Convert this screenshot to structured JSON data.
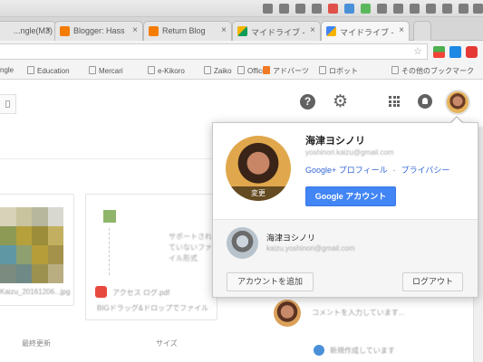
{
  "tabs": [
    {
      "label": "...ngle(M3)",
      "favicon_color": "#bdbdbd"
    },
    {
      "label": "Blogger: Hass",
      "favicon_color": "#f57c00"
    },
    {
      "label": "Return Blog",
      "favicon_color": "#f57c00"
    },
    {
      "label": "マイドライブ -",
      "favicon_color": "#f4b400"
    },
    {
      "label": "マイドライブ -",
      "favicon_color": "#4285f4"
    }
  ],
  "tab_close_glyph": "×",
  "bookmarks": [
    {
      "label": "ngle"
    },
    {
      "label": "Education"
    },
    {
      "label": "Mercari"
    },
    {
      "label": "e-Kikoro"
    },
    {
      "label": "Zaiko"
    },
    {
      "label": "Office"
    },
    {
      "label": "アドバーツ"
    },
    {
      "label": "ロボット"
    },
    {
      "label": "その他のブックマーク"
    }
  ],
  "header": {
    "help_label": "?",
    "settings_icon": "gear-icon",
    "apps_icon": "apps-grid-icon",
    "notifications_icon": "bell-icon"
  },
  "account_popup": {
    "name": "海津ヨシノリ",
    "email": "yoshinori.kaizu@gmail.com",
    "change_photo_label": "変更",
    "profile_link": "Google+ プロフィール",
    "separator": "-",
    "privacy_link": "プライバシー",
    "google_account_button": "Google アカウント",
    "secondary_account": {
      "name": "海津ヨシノリ",
      "email": "kaizu.yoshinori@gmail.com"
    },
    "add_account_button": "アカウントを追加",
    "logout_button": "ログアウト"
  },
  "background": {
    "card_caption_left": "Kaizu_20161206...jpg",
    "preview_text": "サポートされていないファイル形式",
    "file_label_1": "アクセス ログ.pdf",
    "file_label_2": "BIGドラッグ&ドロップでファイル",
    "comment_text": "コメントを入力しています...",
    "footer_left": "最終更新",
    "footer_mid": "サイズ",
    "activity_text": "新規作成しています"
  }
}
